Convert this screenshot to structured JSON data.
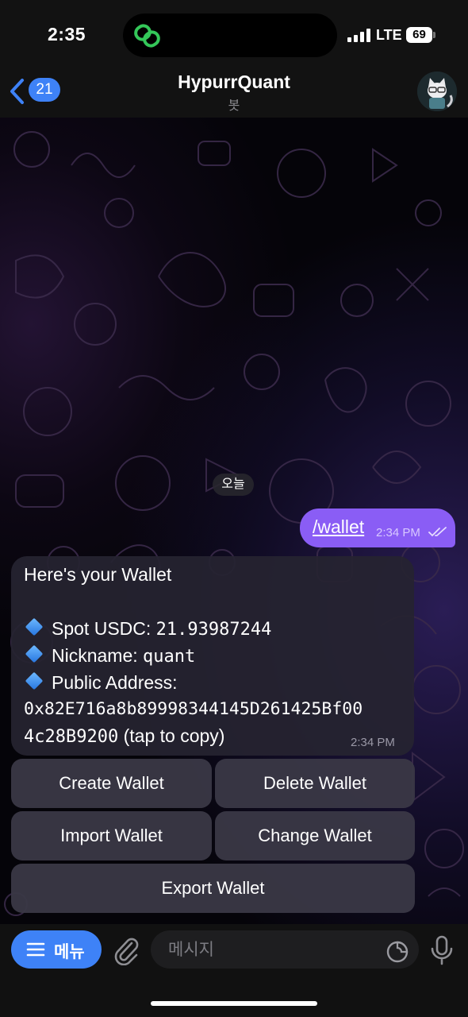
{
  "status_bar": {
    "time": "2:35",
    "network": "LTE",
    "battery": "69"
  },
  "header": {
    "back_count": "21",
    "title": "HypurrQuant",
    "subtitle": "봇"
  },
  "chat": {
    "date_label": "오늘",
    "outgoing": {
      "text": "/wallet",
      "time": "2:34 PM"
    },
    "incoming": {
      "title": "Here's your Wallet",
      "spot_label": "Spot USDC:",
      "spot_value": "21.93987244",
      "nickname_label": "Nickname:",
      "nickname_value": "quant",
      "address_label": "Public Address:",
      "address_line1": "0x82E716a8b89998344145D261425Bf00",
      "address_line2": "4c28B9200",
      "tap_hint": "(tap to copy)",
      "time": "2:34 PM"
    }
  },
  "inline_keyboard": {
    "create": "Create Wallet",
    "delete": "Delete Wallet",
    "import": "Import Wallet",
    "change": "Change Wallet",
    "export": "Export Wallet"
  },
  "input_bar": {
    "menu_label": "메뉴",
    "placeholder": "메시지"
  },
  "colors": {
    "accent": "#3e82f7",
    "outgoing_bubble": "#8a5df5",
    "incoming_bubble": "#262430"
  }
}
